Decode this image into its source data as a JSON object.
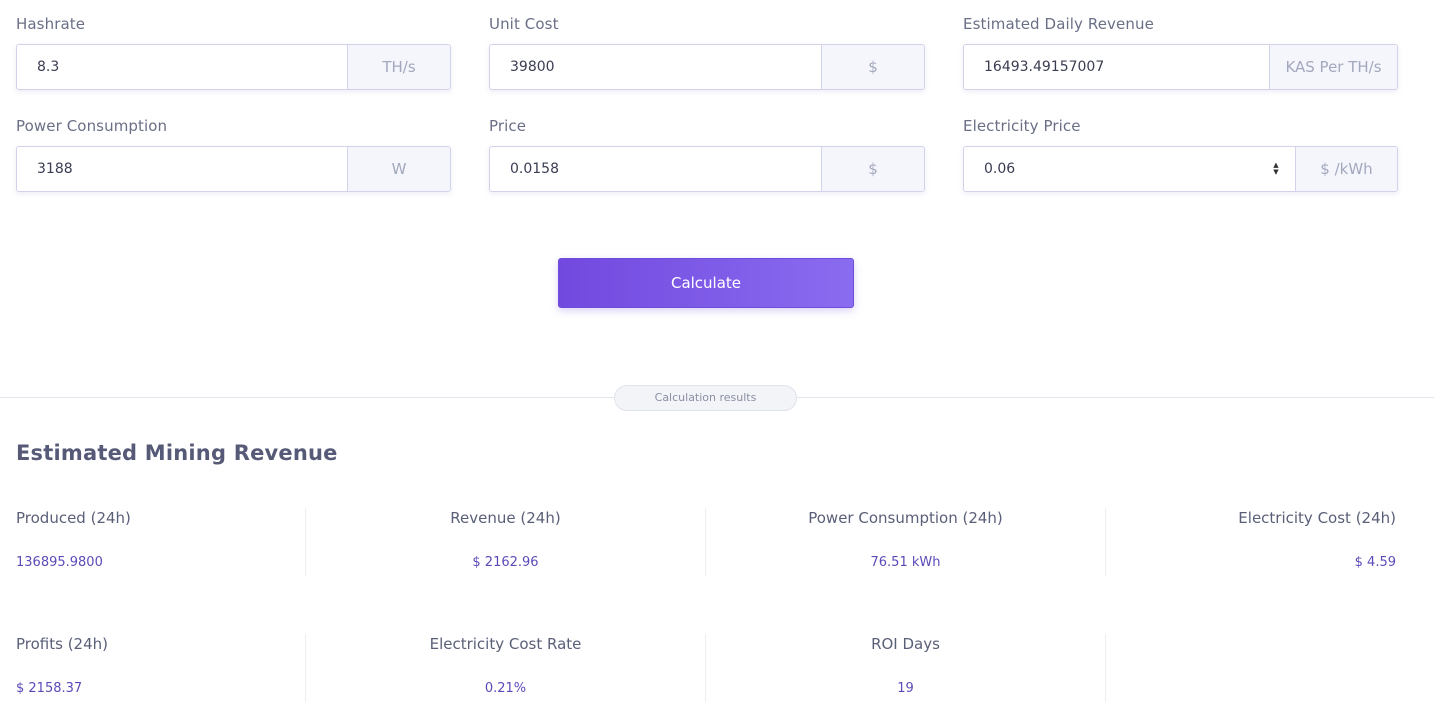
{
  "form": {
    "hashrate": {
      "label": "Hashrate",
      "value": "8.3",
      "unit": "TH/s"
    },
    "unit_cost": {
      "label": "Unit Cost",
      "value": "39800",
      "unit": "$"
    },
    "daily_revenue": {
      "label": "Estimated Daily Revenue",
      "value": "16493.49157007",
      "unit": "KAS Per TH/s"
    },
    "power": {
      "label": "Power Consumption",
      "value": "3188",
      "unit": "W"
    },
    "price": {
      "label": "Price",
      "value": "0.0158",
      "unit": "$"
    },
    "electricity_price": {
      "label": "Electricity Price",
      "value": "0.06",
      "unit": "$ /kWh"
    },
    "calculate_label": "Calculate"
  },
  "divider": {
    "label": "Calculation results"
  },
  "results": {
    "title": "Estimated Mining Revenue",
    "produced": {
      "label": "Produced (24h)",
      "value": "136895.9800"
    },
    "revenue": {
      "label": "Revenue (24h)",
      "value": "$ 2162.96"
    },
    "power_consumption": {
      "label": "Power Consumption (24h)",
      "value": "76.51 kWh"
    },
    "electricity_cost": {
      "label": "Electricity Cost (24h)",
      "value": "$ 4.59"
    },
    "profits": {
      "label": "Profits (24h)",
      "value": "$ 2158.37"
    },
    "electricity_cost_rate": {
      "label": "Electricity Cost Rate",
      "value": "0.21%"
    },
    "roi_days": {
      "label": "ROI Days",
      "value": "19"
    }
  },
  "colors": {
    "accent": "#7a5ae6",
    "value_text": "#5b4bb8"
  }
}
